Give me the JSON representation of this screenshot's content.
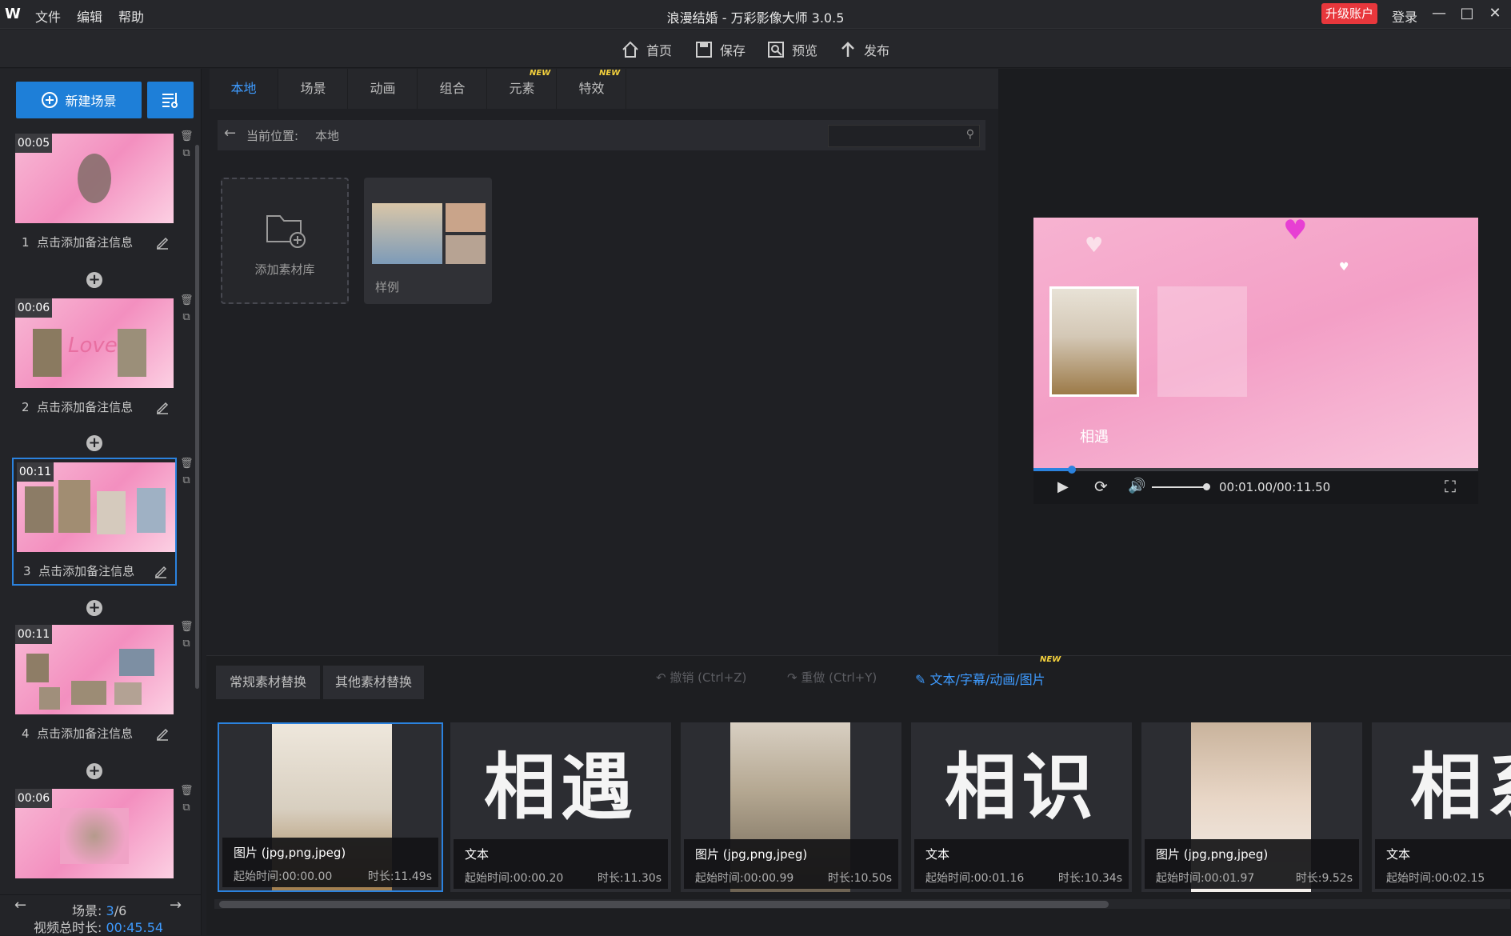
{
  "app": {
    "logo": "W",
    "menus": [
      "文件",
      "编辑",
      "帮助"
    ],
    "title": "浪漫结婚 - 万彩影像大师 3.0.5",
    "upgrade": "升级账户",
    "login": "登录",
    "window_controls": [
      "minimize-icon",
      "maximize-icon",
      "close-icon"
    ]
  },
  "toolbar": {
    "home": "首页",
    "save": "保存",
    "preview": "预览",
    "publish": "发布"
  },
  "left": {
    "new_scene": "新建场景",
    "scenes": [
      {
        "duration": "00:05",
        "index": "1",
        "note": "点击添加备注信息"
      },
      {
        "duration": "00:06",
        "index": "2",
        "note": "点击添加备注信息"
      },
      {
        "duration": "00:11",
        "index": "3",
        "note": "点击添加备注信息"
      },
      {
        "duration": "00:11",
        "index": "4",
        "note": "点击添加备注信息"
      },
      {
        "duration": "00:06",
        "index": "",
        "note": ""
      }
    ],
    "nav_label": "场景:",
    "scene_current": "3",
    "scene_total": "/6",
    "total_label": "视频总时长:",
    "total_duration": "00:45.54"
  },
  "center": {
    "tabs": [
      "本地",
      "场景",
      "动画",
      "组合",
      "元素",
      "特效"
    ],
    "new_badge": "NEW",
    "path_label": "当前位置:",
    "path_value": "本地",
    "search_placeholder": "",
    "add_library": "添加素材库",
    "sample": "样例"
  },
  "preview": {
    "caption": "相遇",
    "time": "00:01.00/00:11.50",
    "progress": 0.087,
    "volume": 1.0
  },
  "bottom": {
    "tabs": [
      "常规素材替换",
      "其他素材替换"
    ],
    "undo": "撤销 (Ctrl+Z)",
    "redo": "重做 (Ctrl+Y)",
    "text_edit": "文本/字幕/动画/图片",
    "new_badge": "NEW",
    "cards": [
      {
        "type": "图片 (jpg,png,jpeg)",
        "start": "起始时间:00:00.00",
        "length": "时长:11.49s",
        "text": ""
      },
      {
        "type": "文本",
        "start": "起始时间:00:00.20",
        "length": "时长:11.30s",
        "text": "相遇"
      },
      {
        "type": "图片 (jpg,png,jpeg)",
        "start": "起始时间:00:00.99",
        "length": "时长:10.50s",
        "text": ""
      },
      {
        "type": "文本",
        "start": "起始时间:00:01.16",
        "length": "时长:10.34s",
        "text": "相识"
      },
      {
        "type": "图片 (jpg,png,jpeg)",
        "start": "起始时间:00:01.97",
        "length": "时长:9.52s",
        "text": ""
      },
      {
        "type": "文本",
        "start": "起始时间:00:02.15",
        "length": "",
        "text": "相系"
      }
    ]
  },
  "colors": {
    "accent": "#1e7fd8",
    "upgrade": "#e8373c",
    "pink": "#f39fc6"
  }
}
